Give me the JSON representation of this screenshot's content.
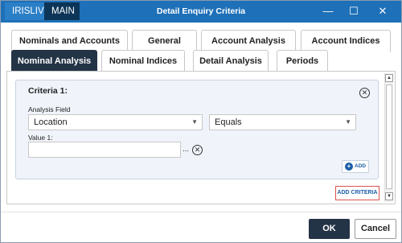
{
  "titlebar": {
    "tag_env": "IRISLIVE",
    "tag_company": "MAIN",
    "title": "Detail Enquiry Criteria",
    "minimize_glyph": "—",
    "maximize_glyph": "☐",
    "close_glyph": "✕"
  },
  "tabs": {
    "row1": [
      "Nominals and Accounts",
      "General",
      "Account Analysis",
      "Account Indices"
    ],
    "row2": [
      "Nominal Analysis",
      "Nominal Indices",
      "Detail Analysis",
      "Periods"
    ],
    "active": "Nominal Analysis"
  },
  "criteria": {
    "title": "Criteria 1:",
    "analysis_field_label": "Analysis Field",
    "analysis_field_value": "Location",
    "operator_value": "Equals",
    "value_label": "Value 1:",
    "value_text": "",
    "ellipsis": "...",
    "add_label": "ADD"
  },
  "add_criteria_label": "ADD CRITERIA",
  "buttons": {
    "ok": "OK",
    "cancel": "Cancel"
  },
  "colors": {
    "titlebar": "#1e70b8",
    "active_tab": "#243447",
    "accent": "#1a5fa8",
    "highlight": "#d9534f"
  }
}
